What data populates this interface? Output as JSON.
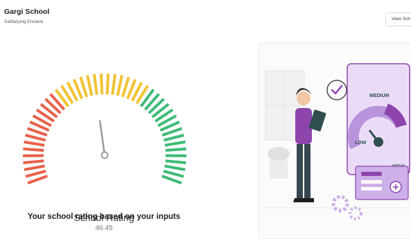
{
  "header": {
    "school_name": "Gargi School",
    "school_location": "Safdarjung Enclave",
    "view_button_label": "View Sch"
  },
  "gauge": {
    "title": "School Rating",
    "value": "46.45",
    "rating_value": 46.45,
    "scale_max": 100,
    "tick_labels": [
      "",
      "",
      "",
      "",
      "",
      "",
      ""
    ],
    "colors": {
      "low": "#e8604a",
      "mid": "#f2c233",
      "high": "#3dbb76",
      "needle": "#9a9a9a"
    }
  },
  "caption": "Your school rating based on your inputs",
  "illustration": {
    "meter_labels": {
      "medium": "MEDIUM",
      "low": "LOW",
      "high": "HIGH"
    },
    "colors": {
      "purple": "#8e44ad",
      "light_purple": "#cdb0e8",
      "teal": "#2f4f4f"
    }
  }
}
